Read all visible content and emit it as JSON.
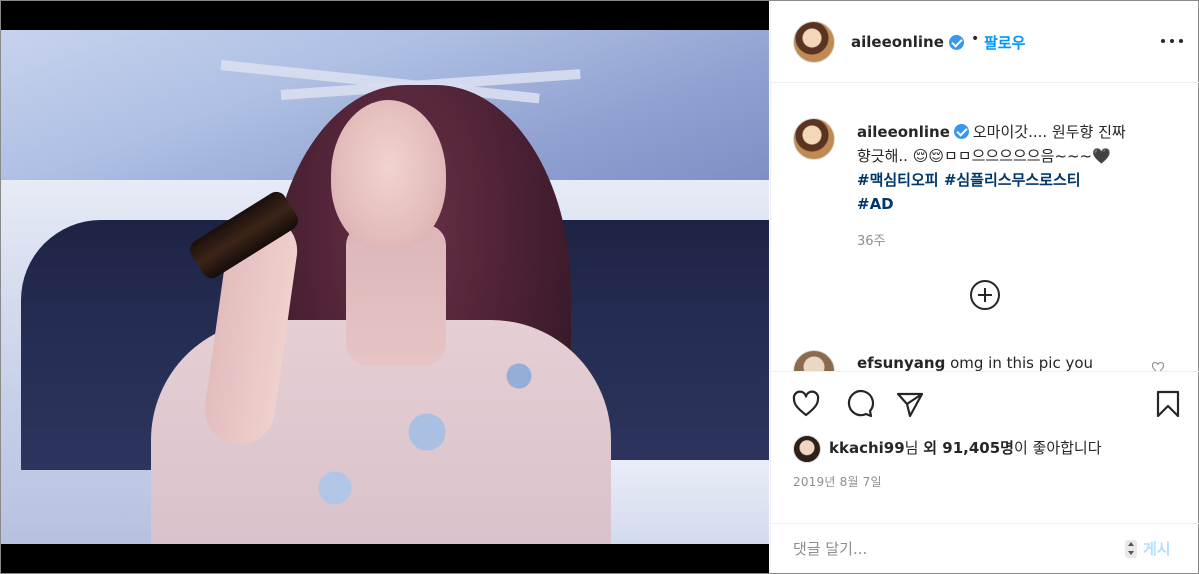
{
  "post": {
    "username": "aileeonline",
    "dot": "•",
    "follow_label": "팔로우",
    "caption": {
      "username": "aileeonline",
      "line1_text": "오마이갓.... 원두향 진짜",
      "line2_text": "향긋해.. 😌😌ㅁㅁ으으으으으음~~~🖤",
      "hashtag1": "#맥심티오피",
      "hashtag2": "#심플리스무스로스티",
      "hashtag3": "#AD",
      "time_ago": "36주"
    },
    "comment_preview": {
      "username": "efsunyang",
      "text": "omg in this pic you"
    },
    "likes": {
      "liker": "kkachi99",
      "suffix1": "님 ",
      "and_label": "외 91,405명",
      "suffix2": "이 좋아합니다"
    },
    "date": "2019년 8월 7일",
    "comment_box": {
      "placeholder": "댓글 달기...",
      "post_label": "게시"
    }
  },
  "colors": {
    "accent": "#0095f6",
    "verified": "#3897f0",
    "hashtag": "#00376b",
    "muted": "#8e8e8e",
    "post_disabled": "#b2dffc"
  },
  "icons": [
    "more-icon",
    "verified-icon",
    "load-more-icon",
    "heart-icon",
    "comment-icon",
    "share-icon",
    "bookmark-icon"
  ]
}
